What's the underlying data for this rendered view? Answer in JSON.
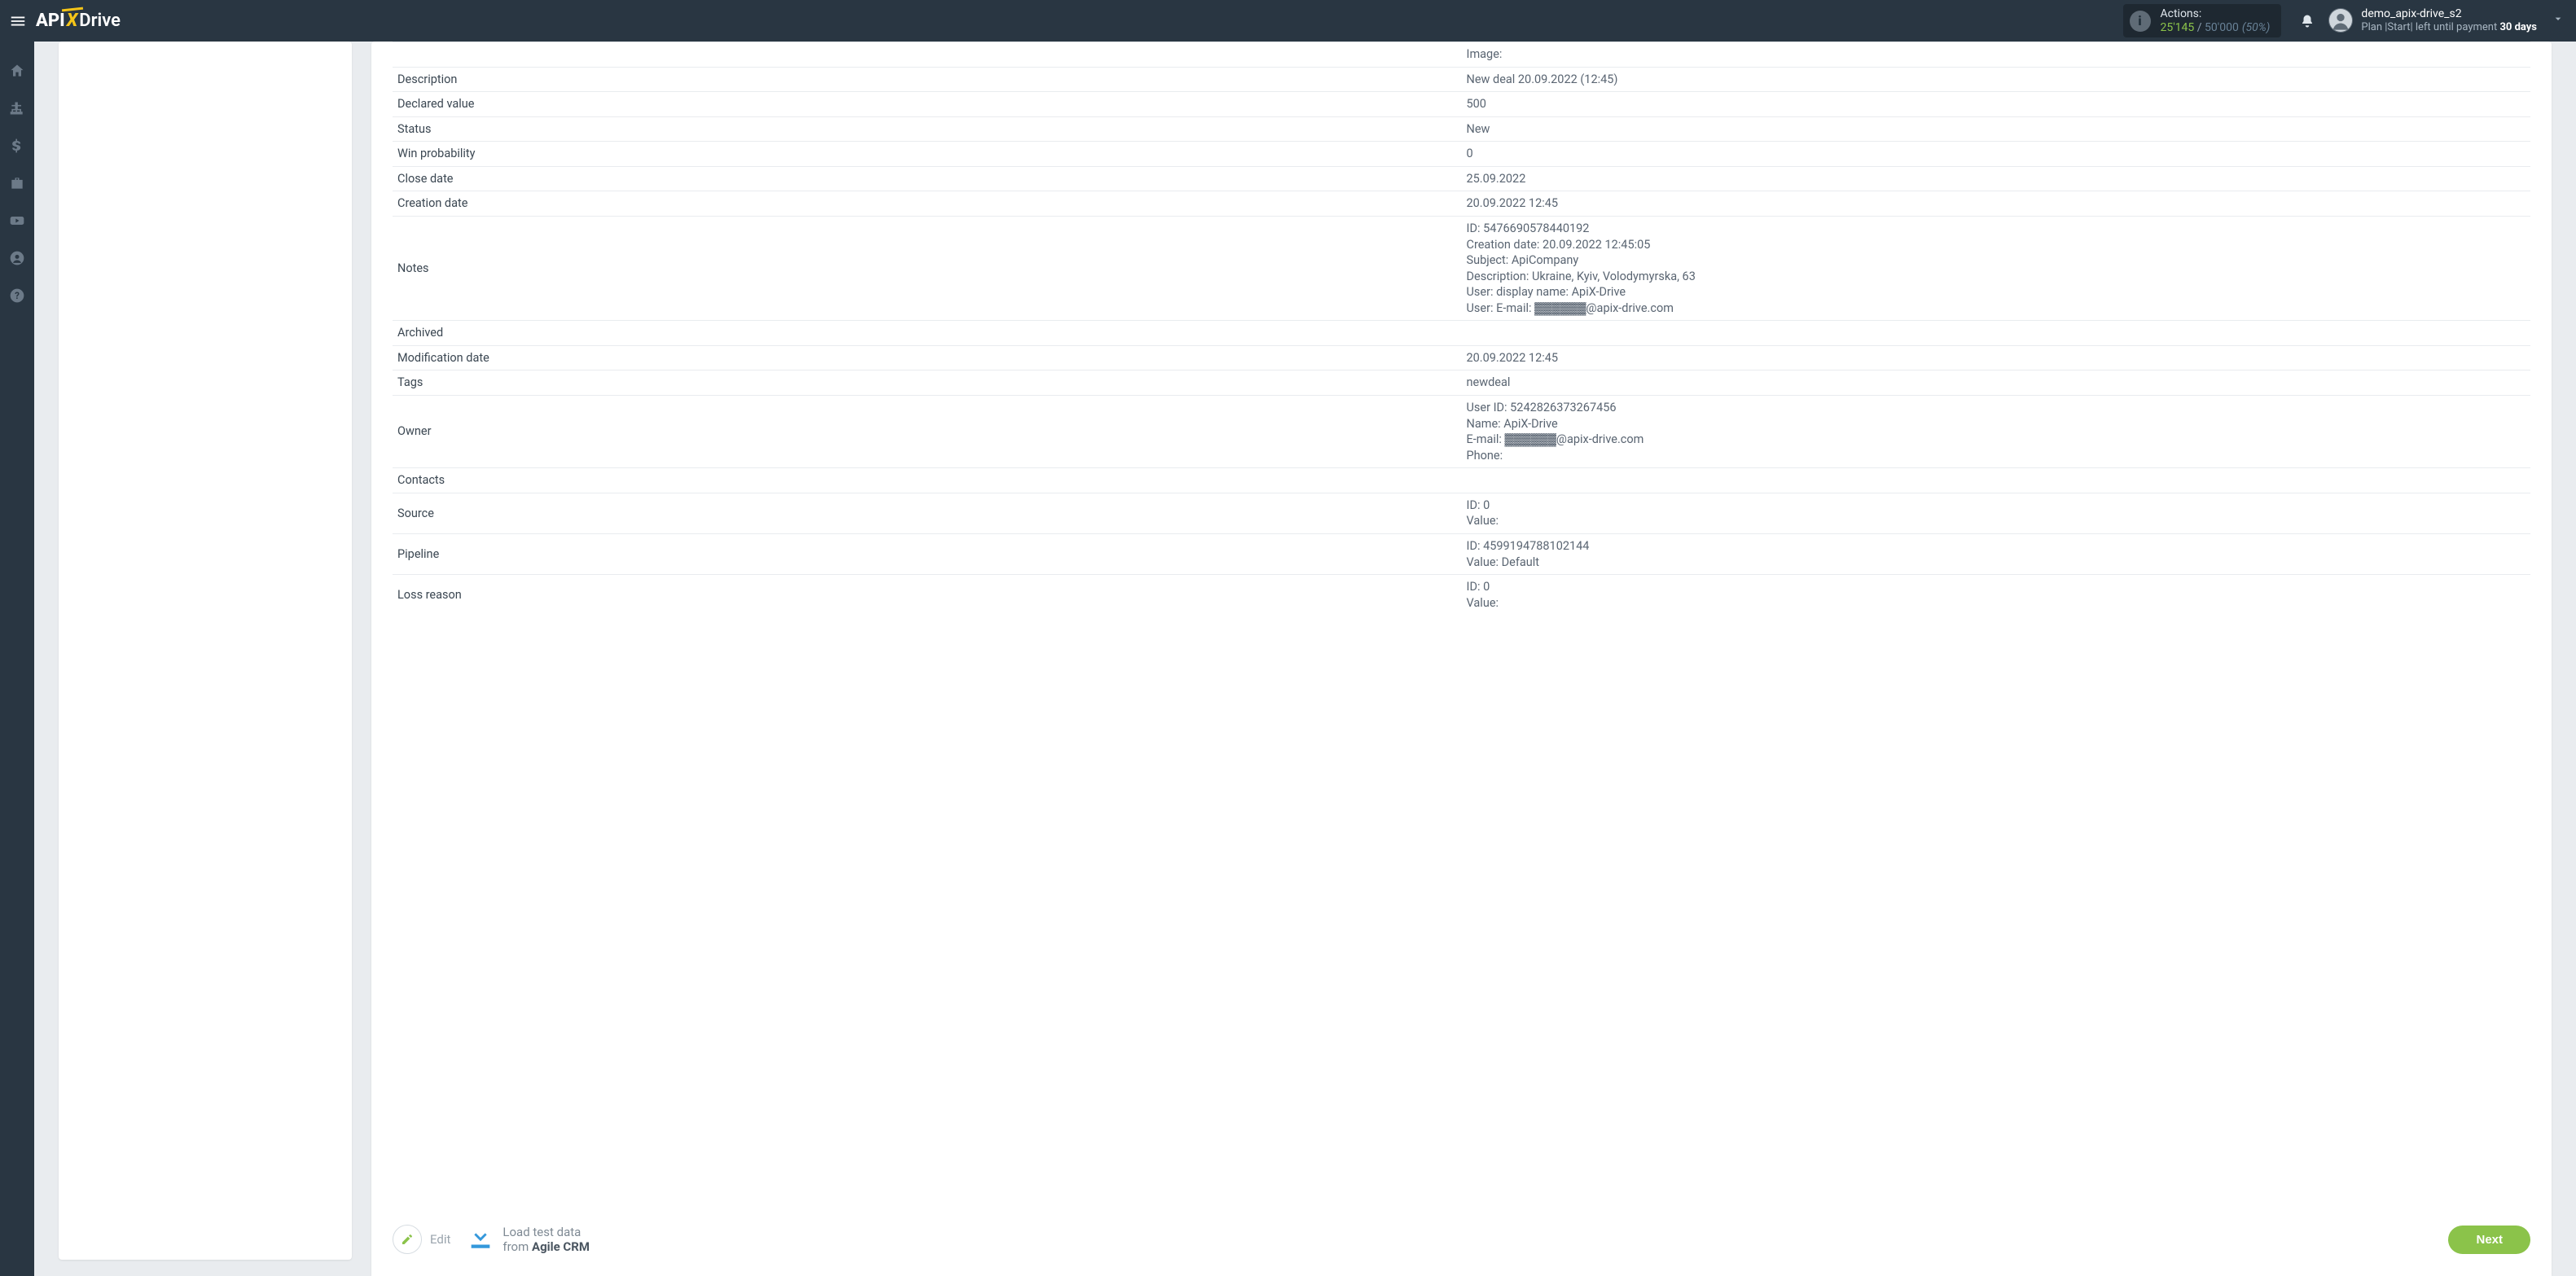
{
  "header": {
    "actions_label": "Actions:",
    "actions_current": "25'145",
    "actions_sep": " / ",
    "actions_max": "50'000",
    "actions_pct": "(50%)",
    "user_name": "demo_apix-drive_s2",
    "user_plan_prefix": "Plan |Start| left until payment ",
    "user_plan_days": "30 days"
  },
  "rows": [
    {
      "key": "",
      "val": "Image:"
    },
    {
      "key": "Description",
      "val": "New deal 20.09.2022 (12:45)"
    },
    {
      "key": "Declared value",
      "val": "500"
    },
    {
      "key": "Status",
      "val": "New"
    },
    {
      "key": "Win probability",
      "val": "0"
    },
    {
      "key": "Close date",
      "val": "25.09.2022"
    },
    {
      "key": "Creation date",
      "val": "20.09.2022 12:45"
    },
    {
      "key": "Notes",
      "val": "ID: 5476690578440192\nCreation date: 20.09.2022 12:45:05\nSubject: ApiCompany\nDescription: Ukraine, Kyiv, Volodymyrska, 63\nUser: display name: ApiX-Drive\nUser: E-mail: ▓▓▓▓▓▓@apix-drive.com"
    },
    {
      "key": "Archived",
      "val": ""
    },
    {
      "key": "Modification date",
      "val": "20.09.2022 12:45"
    },
    {
      "key": "Tags",
      "val": "newdeal"
    },
    {
      "key": "Owner",
      "val": "User ID: 5242826373267456\nName: ApiX-Drive\nE-mail: ▓▓▓▓▓▓@apix-drive.com\nPhone:"
    },
    {
      "key": "Contacts",
      "val": ""
    },
    {
      "key": "Source",
      "val": "ID: 0\nValue:"
    },
    {
      "key": "Pipeline",
      "val": "ID: 4599194788102144\nValue: Default"
    },
    {
      "key": "Loss reason",
      "val": "ID: 0\nValue:"
    }
  ],
  "footer": {
    "edit_label": "Edit",
    "load_line1": "Load test data",
    "load_line2_prefix": "from ",
    "load_line2_bold": "Agile CRM",
    "next_label": "Next"
  }
}
